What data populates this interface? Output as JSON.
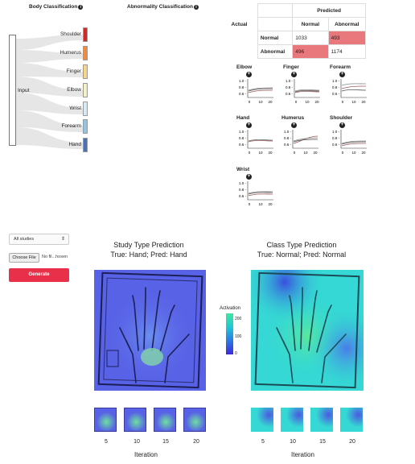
{
  "headers": {
    "body_classification": "Body Classification",
    "abnormality_classification": "Abnormality Classification"
  },
  "sankey": {
    "input_label": "Input",
    "body_parts": [
      {
        "label": "Shoulder",
        "color": "#d62728"
      },
      {
        "label": "Humerus",
        "color": "#f58a3a"
      },
      {
        "label": "Finger",
        "color": "#f5d689"
      },
      {
        "label": "Elbow",
        "color": "#f3f1c4"
      },
      {
        "label": "Wrist",
        "color": "#d6eaf4"
      },
      {
        "label": "Forearm",
        "color": "#93c4e0"
      },
      {
        "label": "Hand",
        "color": "#4a72b8"
      }
    ]
  },
  "confusion_matrix": {
    "predicted_label": "Predicted",
    "actual_label": "Actual",
    "col_normal": "Normal",
    "col_abnormal": "Abnormal",
    "row_normal": "Normal",
    "row_abnormal": "Abnormal",
    "cells": {
      "nn": "1033",
      "na": "493",
      "an": "496",
      "aa": "1174"
    },
    "highlight_color": "#e8787c"
  },
  "mini_charts": {
    "y_ticks": [
      "1.0",
      "0.8",
      "0.6"
    ],
    "x_ticks": [
      "0",
      "10",
      "20"
    ],
    "items": [
      "Elbow",
      "Finger",
      "Forearm",
      "Hand",
      "Humerus",
      "Shoulder",
      "Wrist"
    ]
  },
  "controls": {
    "studies_select": "All studies",
    "choose_file": "Choose File",
    "file_name": "No fil...hosen",
    "generate": "Generate"
  },
  "study_panel": {
    "title": "Study Type Prediction",
    "subtitle": "True: Hand; Pred: Hand"
  },
  "class_panel": {
    "title": "Class Type Prediction",
    "subtitle": "True: Normal; Pred: Normal"
  },
  "colorbar": {
    "label": "Activation",
    "ticks": [
      "200",
      "100",
      "0"
    ]
  },
  "iteration": {
    "label": "Iteration",
    "ticks": [
      "5",
      "10",
      "15",
      "20"
    ]
  }
}
